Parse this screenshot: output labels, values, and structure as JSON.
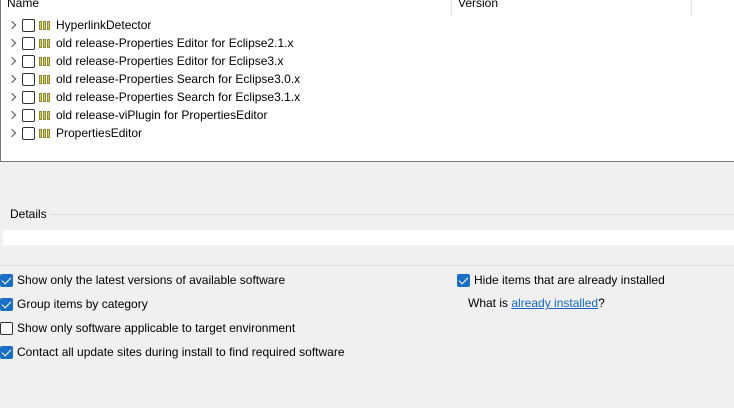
{
  "tree": {
    "columns": {
      "name": "Name",
      "version": "Version"
    },
    "rows": [
      {
        "label": "HyperlinkDetector"
      },
      {
        "label": "old release-Properties Editor for Eclipse2.1.x"
      },
      {
        "label": "old release-Properties Editor for Eclipse3.x"
      },
      {
        "label": "old release-Properties Search for Eclipse3.0.x"
      },
      {
        "label": "old release-Properties Search for Eclipse3.1.x"
      },
      {
        "label": "old release-viPlugin for PropertiesEditor"
      },
      {
        "label": "PropertiesEditor"
      }
    ]
  },
  "details": {
    "title": "Details",
    "text": ""
  },
  "options": {
    "latest_versions": {
      "label": "Show only the latest versions of available software",
      "checked": true
    },
    "group_by_category": {
      "label": "Group items by category",
      "checked": true
    },
    "target_env": {
      "label": "Show only software applicable to target environment",
      "checked": false
    },
    "contact_sites": {
      "label": "Contact all update sites during install to find required software",
      "checked": true
    },
    "hide_installed": {
      "label": "Hide items that are already installed",
      "checked": true
    }
  },
  "what_is": {
    "prefix": "What is ",
    "link": "already installed",
    "suffix": "?"
  },
  "colors": {
    "accent": "#1a6fc4",
    "link": "#1565c0"
  }
}
